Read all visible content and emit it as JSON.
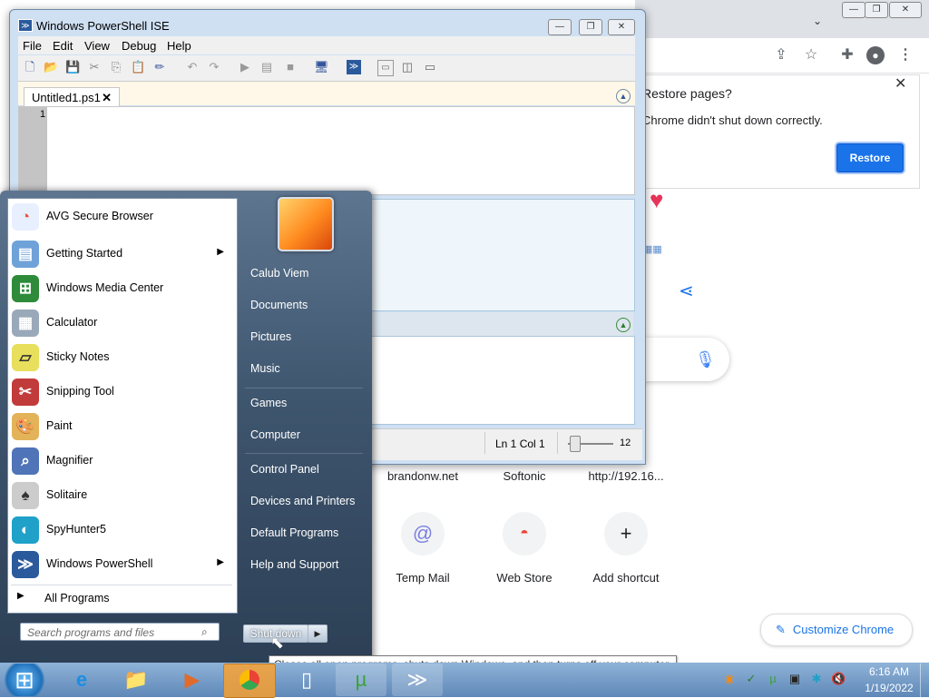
{
  "chrome": {
    "restore_title": "Restore pages?",
    "restore_message": "Chrome didn't shut down correctly.",
    "restore_button": "Restore",
    "customize_label": "Customize Chrome",
    "shortcuts_top": [
      "brandonw.net",
      "Softonic",
      "http://192.16..."
    ],
    "shortcuts_bottom": [
      {
        "label": "Temp Mail",
        "icon": "at-icon"
      },
      {
        "label": "Web Store",
        "icon": "web-store-icon"
      },
      {
        "label": "Add shortcut",
        "icon": "plus-icon"
      }
    ]
  },
  "ise": {
    "title": "Windows PowerShell ISE",
    "menus": [
      "File",
      "Edit",
      "View",
      "Debug",
      "Help"
    ],
    "tab_label": "Untitled1.ps1",
    "line_number": "1",
    "status_position": "Ln 1  Col 1",
    "zoom_value": "12"
  },
  "start_menu": {
    "programs": [
      {
        "label": "AVG Secure Browser",
        "icon": "avg-icon",
        "color": "#e8f0ff",
        "submenu": false
      },
      {
        "label": "Getting Started",
        "icon": "getting-started-icon",
        "color": "#6fa2d8",
        "submenu": true
      },
      {
        "label": "Windows Media Center",
        "icon": "media-center-icon",
        "color": "#2e8b3a",
        "submenu": false
      },
      {
        "label": "Calculator",
        "icon": "calculator-icon",
        "color": "#9aa9b9",
        "submenu": false
      },
      {
        "label": "Sticky Notes",
        "icon": "sticky-notes-icon",
        "color": "#e8df5c",
        "submenu": false
      },
      {
        "label": "Snipping Tool",
        "icon": "scissors-icon",
        "color": "#c23b3b",
        "submenu": false
      },
      {
        "label": "Paint",
        "icon": "paint-icon",
        "color": "#e3b35a",
        "submenu": false
      },
      {
        "label": "Magnifier",
        "icon": "magnifier-icon",
        "color": "#4f74b8",
        "submenu": false
      },
      {
        "label": "Solitaire",
        "icon": "solitaire-icon",
        "color": "#cccccc",
        "submenu": false
      },
      {
        "label": "SpyHunter5",
        "icon": "spyhunter-icon",
        "color": "#1fa1c9",
        "submenu": false
      },
      {
        "label": "Windows PowerShell",
        "icon": "powershell-icon",
        "color": "#2a5a9b",
        "submenu": true
      }
    ],
    "all_programs": "All Programs",
    "search_placeholder": "Search programs and files",
    "right_links": [
      "Calub Viem",
      "Documents",
      "Pictures",
      "Music",
      "Games",
      "Computer",
      "Control Panel",
      "Devices and Printers",
      "Default Programs",
      "Help and Support"
    ],
    "shutdown_label": "Shut down",
    "tooltip": "Closes all open programs, shuts down Windows, and then turns off your computer."
  },
  "taskbar": {
    "time": "6:16 AM",
    "date": "1/19/2022"
  }
}
